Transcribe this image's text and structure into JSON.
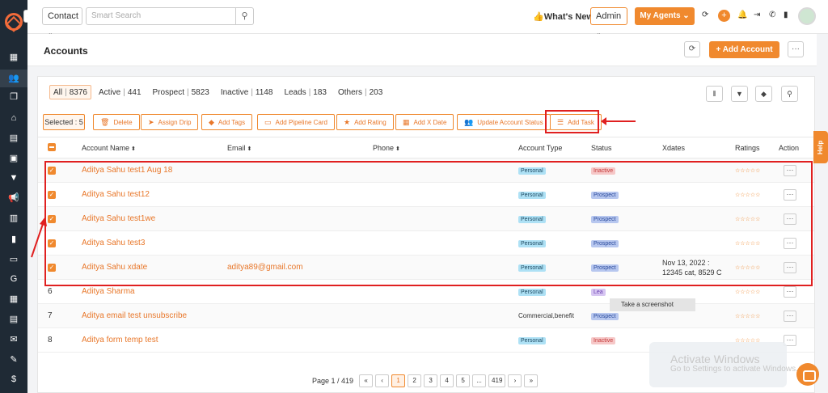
{
  "topbar": {
    "contact_select": "Contact",
    "search_placeholder": "Smart Search",
    "whats_new": "What's New",
    "admin_select": "Admin",
    "my_agents": "My Agents"
  },
  "header": {
    "title": "Accounts",
    "add_account": "Add Account"
  },
  "filters": [
    {
      "label": "All",
      "count": "8376",
      "active": true
    },
    {
      "label": "Active",
      "count": "441"
    },
    {
      "label": "Prospect",
      "count": "5823"
    },
    {
      "label": "Inactive",
      "count": "1148"
    },
    {
      "label": "Leads",
      "count": "183"
    },
    {
      "label": "Others",
      "count": "203"
    }
  ],
  "bulk_actions": {
    "selected": "Selected : 5",
    "delete": "Delete",
    "assign_drip": "Assign Drip",
    "add_tags": "Add Tags",
    "add_pipeline_card": "Add Pipeline Card",
    "add_rating": "Add Rating",
    "add_x_date": "Add X Date",
    "update_status": "Update Account Status",
    "add_task": "Add Task"
  },
  "table": {
    "headers": {
      "account_name": "Account Name",
      "email": "Email",
      "phone": "Phone",
      "account_type": "Account Type",
      "status": "Status",
      "xdates": "Xdates",
      "ratings": "Ratings",
      "action": "Action"
    },
    "rows": [
      {
        "num": "",
        "checked": true,
        "name": "Aditya Sahu test1 Aug 18",
        "email": "",
        "type": "Personal",
        "status": "Inactive",
        "xdates": ""
      },
      {
        "num": "",
        "checked": true,
        "name": "Aditya Sahu test12",
        "email": "",
        "type": "Personal",
        "status": "Prospect",
        "xdates": ""
      },
      {
        "num": "",
        "checked": true,
        "name": "Aditya Sahu test1we",
        "email": "",
        "type": "Personal",
        "status": "Prospect",
        "xdates": ""
      },
      {
        "num": "",
        "checked": true,
        "name": "Aditya Sahu test3",
        "email": "",
        "type": "Personal",
        "status": "Prospect",
        "xdates": ""
      },
      {
        "num": "",
        "checked": true,
        "name": "Aditya Sahu xdate",
        "email": "aditya89@gmail.com",
        "type": "Personal",
        "status": "Prospect",
        "xdates": "Nov 13, 2022 : 12345 cat, 8529 C"
      },
      {
        "num": "6",
        "checked": false,
        "name": "Aditya Sharma",
        "email": "",
        "type": "Personal",
        "status": "Lea",
        "xdates": ""
      },
      {
        "num": "7",
        "checked": false,
        "name": "Aditya email test unsubscribe",
        "email": "",
        "type": "Commercial,benefit",
        "status": "Prospect",
        "xdates": ""
      },
      {
        "num": "8",
        "checked": false,
        "name": "Aditya form temp test",
        "email": "",
        "type": "Personal",
        "status": "Inactive",
        "xdates": ""
      }
    ],
    "stars": "☆☆☆☆☆"
  },
  "tooltip": "Take a screenshot",
  "pagination": {
    "label": "Page 1 / 419",
    "first": "«",
    "prev": "‹",
    "pages": [
      "1",
      "2",
      "3",
      "4",
      "5",
      "...",
      "419"
    ],
    "next": "›",
    "last": "»"
  },
  "watermark": {
    "line1": "Activate Windows",
    "line2": "Go to Settings to activate Windows."
  },
  "help": "Help"
}
